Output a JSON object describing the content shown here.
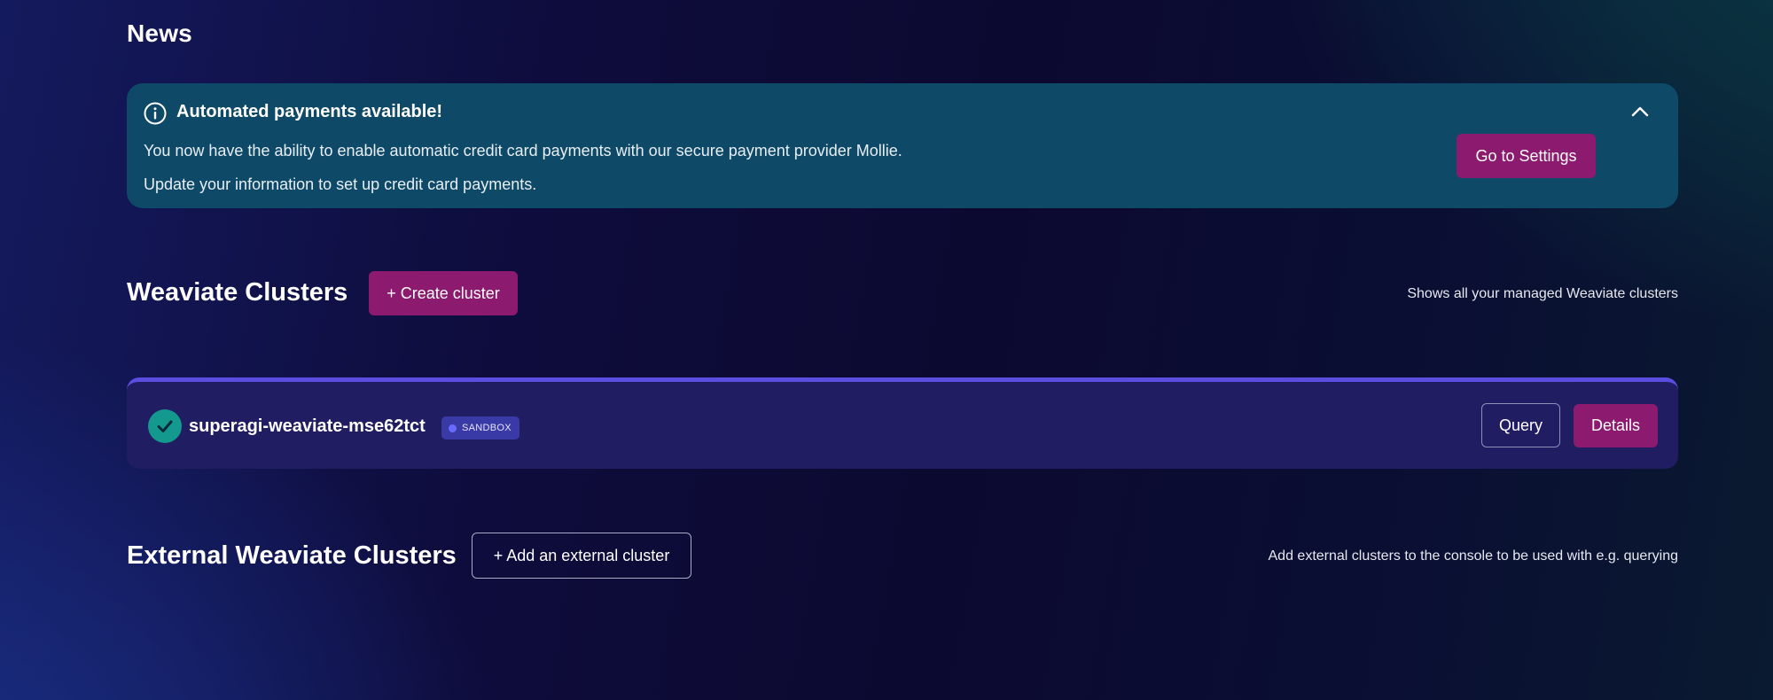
{
  "news": {
    "title": "News",
    "card": {
      "heading": "Automated payments available!",
      "line1": "You now have the ability to enable automatic credit card payments with our secure payment provider Mollie.",
      "line2": "Update your information to set up credit card payments.",
      "settings_label": "Go to Settings",
      "icons": {
        "info": "info-circle-icon",
        "collapse": "chevron-up-icon"
      }
    }
  },
  "clusters": {
    "title": "Weaviate Clusters",
    "create_label": "+ Create cluster",
    "note": "Shows all your managed Weaviate clusters",
    "items": [
      {
        "name": "superagi-weaviate-mse62tct",
        "badge": "SANDBOX",
        "status_icon": "check-circle-icon",
        "query_label": "Query",
        "details_label": "Details"
      }
    ]
  },
  "external": {
    "title": "External Weaviate Clusters",
    "add_label": "+ Add an external cluster",
    "note": "Add external clusters to the console to be used with e.g. querying"
  },
  "colors": {
    "accent_magenta": "#8c1a6e",
    "news_card_bg": "#0e4a68",
    "cluster_card_bg": "#201d63",
    "cluster_card_top_border": "#5b4de0",
    "status_ok": "#14998e",
    "badge_bg": "#3a3aa6"
  }
}
